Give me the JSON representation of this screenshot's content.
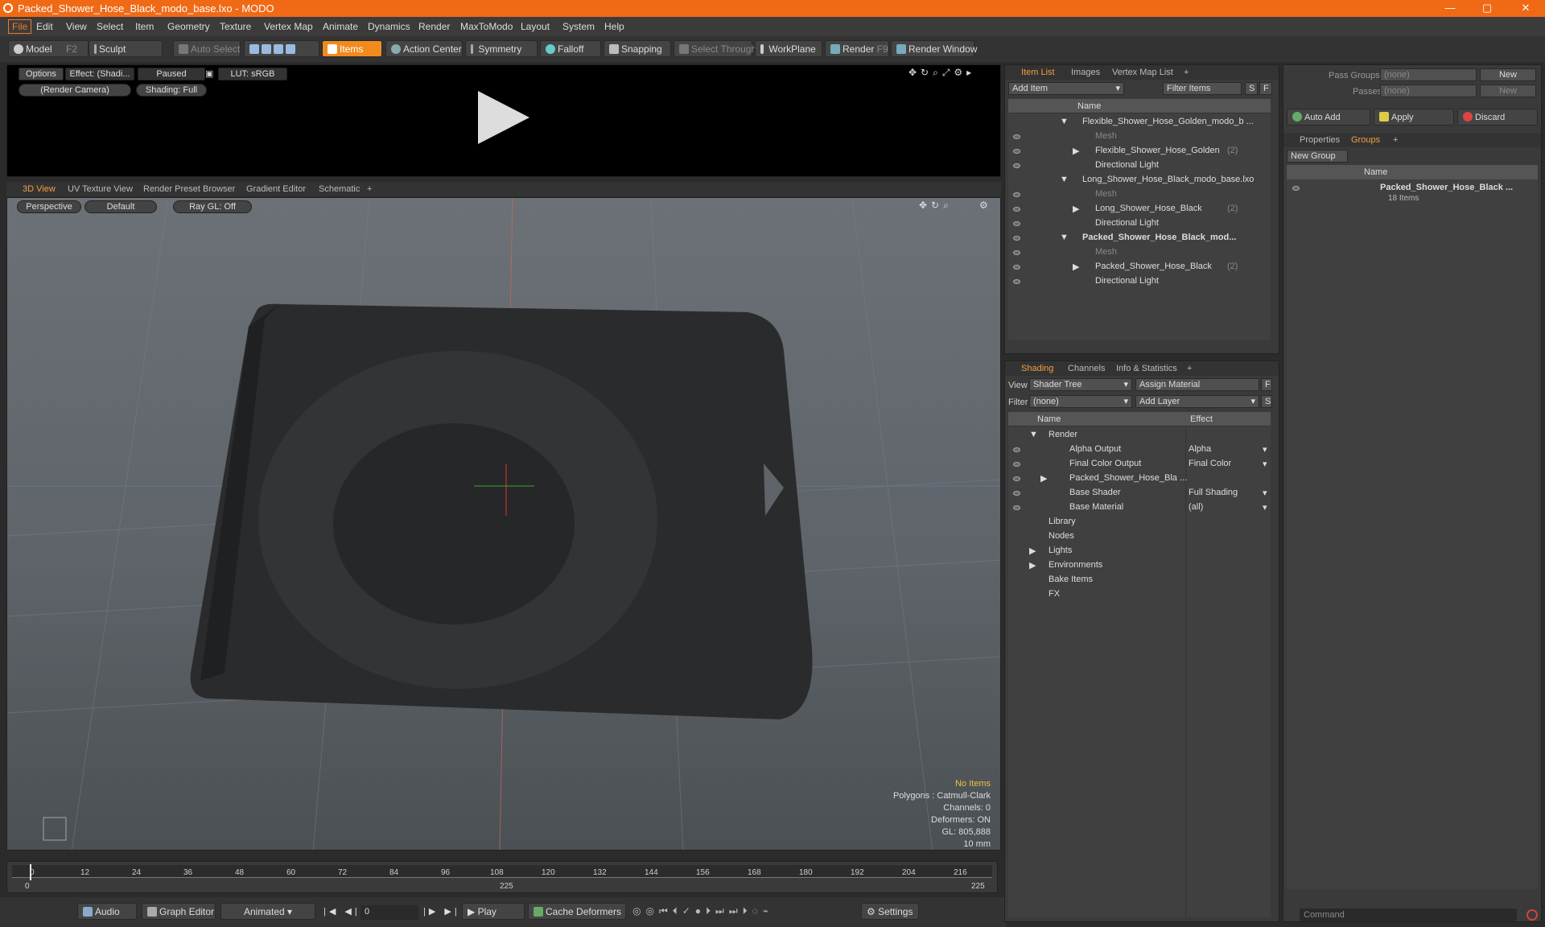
{
  "window": {
    "title": "Packed_Shower_Hose_Black_modo_base.lxo - MODO",
    "min": "—",
    "max": "▢",
    "close": "✕"
  },
  "menu": [
    "File",
    "Edit",
    "View",
    "Select",
    "Item",
    "Geometry",
    "Texture",
    "Vertex Map",
    "Animate",
    "Dynamics",
    "Render",
    "MaxToModo",
    "Layout",
    "System",
    "Help"
  ],
  "toolbar": {
    "model": "Model",
    "model_key": "F2",
    "sculpt": "Sculpt",
    "auto_select": "Auto Select",
    "items": "Items",
    "action_center": "Action Center",
    "symmetry": "Symmetry",
    "falloff": "Falloff",
    "snapping": "Snapping",
    "select_through": "Select Through",
    "workplane": "WorkPlane",
    "render": "Render",
    "render_key": "F9",
    "render_window": "Render Window"
  },
  "preview": {
    "options": "Options",
    "effect": "Effect: (Shadi...",
    "paused": "Paused",
    "lut": "LUT: sRGB",
    "camera": "(Render Camera)",
    "shading": "Shading: Full"
  },
  "viewtabs": [
    "3D View",
    "UV Texture View",
    "Render Preset Browser",
    "Gradient Editor",
    "Schematic"
  ],
  "viewport": {
    "perspective": "Perspective",
    "default": "Default",
    "raygl": "Ray GL: Off",
    "info": [
      "No Items",
      "Polygons : Catmull-Clark",
      "Channels: 0",
      "Deformers: ON",
      "GL: 805,888",
      "10 mm"
    ]
  },
  "timeline": {
    "ticks": [
      "0",
      "12",
      "24",
      "36",
      "48",
      "60",
      "72",
      "84",
      "96",
      "108",
      "120",
      "132",
      "144",
      "156",
      "168",
      "180",
      "192",
      "204",
      "216"
    ],
    "start": "0",
    "mid": "225",
    "end": "225"
  },
  "bottom": {
    "audio": "Audio",
    "graph_editor": "Graph Editor",
    "animated": "Animated",
    "frame": "0",
    "play": "Play",
    "cache": "Cache Deformers",
    "settings": "Settings"
  },
  "itemlist": {
    "tabs": [
      "Item List",
      "Images",
      "Vertex Map List"
    ],
    "add_item": "Add Item",
    "filter": "Filter Items",
    "s": "S",
    "f": "F",
    "col": "Name",
    "rows": [
      {
        "t": "Flexible_Shower_Hose_Golden_modo_b ...",
        "lvl": 0,
        "exp": "▼",
        "eye": false,
        "bold": false
      },
      {
        "t": "Mesh",
        "lvl": 1,
        "exp": "",
        "eye": true,
        "dim": true
      },
      {
        "t": "Flexible_Shower_Hose_Golden",
        "cnt": "(2)",
        "lvl": 1,
        "exp": "▶",
        "eye": true
      },
      {
        "t": "Directional Light",
        "lvl": 1,
        "exp": "",
        "eye": true
      },
      {
        "t": "Long_Shower_Hose_Black_modo_base.lxo",
        "lvl": 0,
        "exp": "▼",
        "eye": false
      },
      {
        "t": "Mesh",
        "lvl": 1,
        "exp": "",
        "eye": true,
        "dim": true
      },
      {
        "t": "Long_Shower_Hose_Black",
        "cnt": "(2)",
        "lvl": 1,
        "exp": "▶",
        "eye": true
      },
      {
        "t": "Directional Light",
        "lvl": 1,
        "exp": "",
        "eye": true
      },
      {
        "t": "Packed_Shower_Hose_Black_mod...",
        "lvl": 0,
        "exp": "▼",
        "eye": true,
        "bold": true
      },
      {
        "t": "Mesh",
        "lvl": 1,
        "exp": "",
        "eye": true,
        "dim": true
      },
      {
        "t": "Packed_Shower_Hose_Black",
        "cnt": "(2)",
        "lvl": 1,
        "exp": "▶",
        "eye": true
      },
      {
        "t": "Directional Light",
        "lvl": 1,
        "exp": "",
        "eye": true
      }
    ]
  },
  "shading": {
    "tabs": [
      "Shading",
      "Channels",
      "Info & Statistics"
    ],
    "view_label": "View",
    "view_val": "Shader Tree",
    "assign": "Assign Material",
    "filter_label": "Filter",
    "filter_val": "(none)",
    "add_layer": "Add Layer",
    "col_name": "Name",
    "col_effect": "Effect",
    "rows": [
      {
        "t": "Render",
        "e": "",
        "lvl": 0,
        "exp": "▼",
        "eye": false
      },
      {
        "t": "Alpha Output",
        "e": "Alpha",
        "lvl": 1,
        "eye": true
      },
      {
        "t": "Final Color Output",
        "e": "Final Color",
        "lvl": 1,
        "eye": true
      },
      {
        "t": "Packed_Shower_Hose_Bla ...",
        "e": "",
        "lvl": 1,
        "exp": "▶",
        "eye": true
      },
      {
        "t": "Base Shader",
        "e": "Full Shading",
        "lvl": 1,
        "eye": true
      },
      {
        "t": "Base Material",
        "e": "(all)",
        "lvl": 1,
        "eye": true
      },
      {
        "t": "Library",
        "e": "",
        "lvl": 0,
        "eye": false
      },
      {
        "t": "Nodes",
        "e": "",
        "lvl": 0,
        "eye": false
      },
      {
        "t": "Lights",
        "e": "",
        "lvl": 0,
        "exp": "▶",
        "eye": false
      },
      {
        "t": "Environments",
        "e": "",
        "lvl": 0,
        "exp": "▶",
        "eye": false
      },
      {
        "t": "Bake Items",
        "e": "",
        "lvl": 0,
        "eye": false
      },
      {
        "t": "FX",
        "e": "",
        "lvl": 0,
        "eye": false
      }
    ]
  },
  "groups": {
    "pass_groups": "Pass Groups",
    "passes": "Passes",
    "none": "(none)",
    "new": "New",
    "auto_add": "Auto Add",
    "apply": "Apply",
    "discard": "Discard",
    "tabs": [
      "Properties",
      "Groups"
    ],
    "new_group": "New Group",
    "col": "Name",
    "item": "Packed_Shower_Hose_Black ...",
    "count": "18 Items"
  },
  "command": {
    "placeholder": "Command"
  }
}
